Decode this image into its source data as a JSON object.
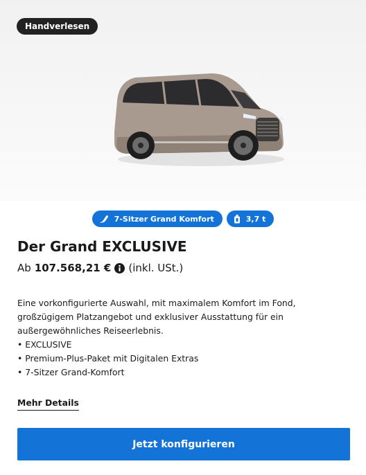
{
  "badge": {
    "label": "Handverlesen"
  },
  "vehicle": {
    "image_name": "van-image",
    "body_color": "#a89a8e"
  },
  "chips": [
    {
      "icon": "seat-icon",
      "label": "7-Sitzer Grand Komfort"
    },
    {
      "icon": "weight-icon",
      "label": "3,7 t"
    }
  ],
  "product": {
    "title": "Der Grand EXCLUSIVE",
    "price_prefix": "Ab",
    "price": "107.568,21 €",
    "price_info_icon": "info-icon",
    "price_note": "(inkl. USt.)"
  },
  "description": {
    "lines": [
      "Eine vorkonfigurierte Auswahl, mit maximalem Komfort im Fond,",
      "großzügigem Platzangebot und exklusiver Ausstattung für ein",
      "außergewöhnliches Reiseerlebnis."
    ],
    "bullets": [
      "EXCLUSIVE",
      "Premium-Plus-Paket mit Digitalen Extras",
      "7-Sitzer Grand-Komfort"
    ]
  },
  "links": {
    "details": "Mehr Details"
  },
  "cta": {
    "label": "Jetzt konfigurieren"
  },
  "colors": {
    "accent": "#1473d6",
    "badge_bg": "#222222",
    "text": "#1a1a1a"
  }
}
